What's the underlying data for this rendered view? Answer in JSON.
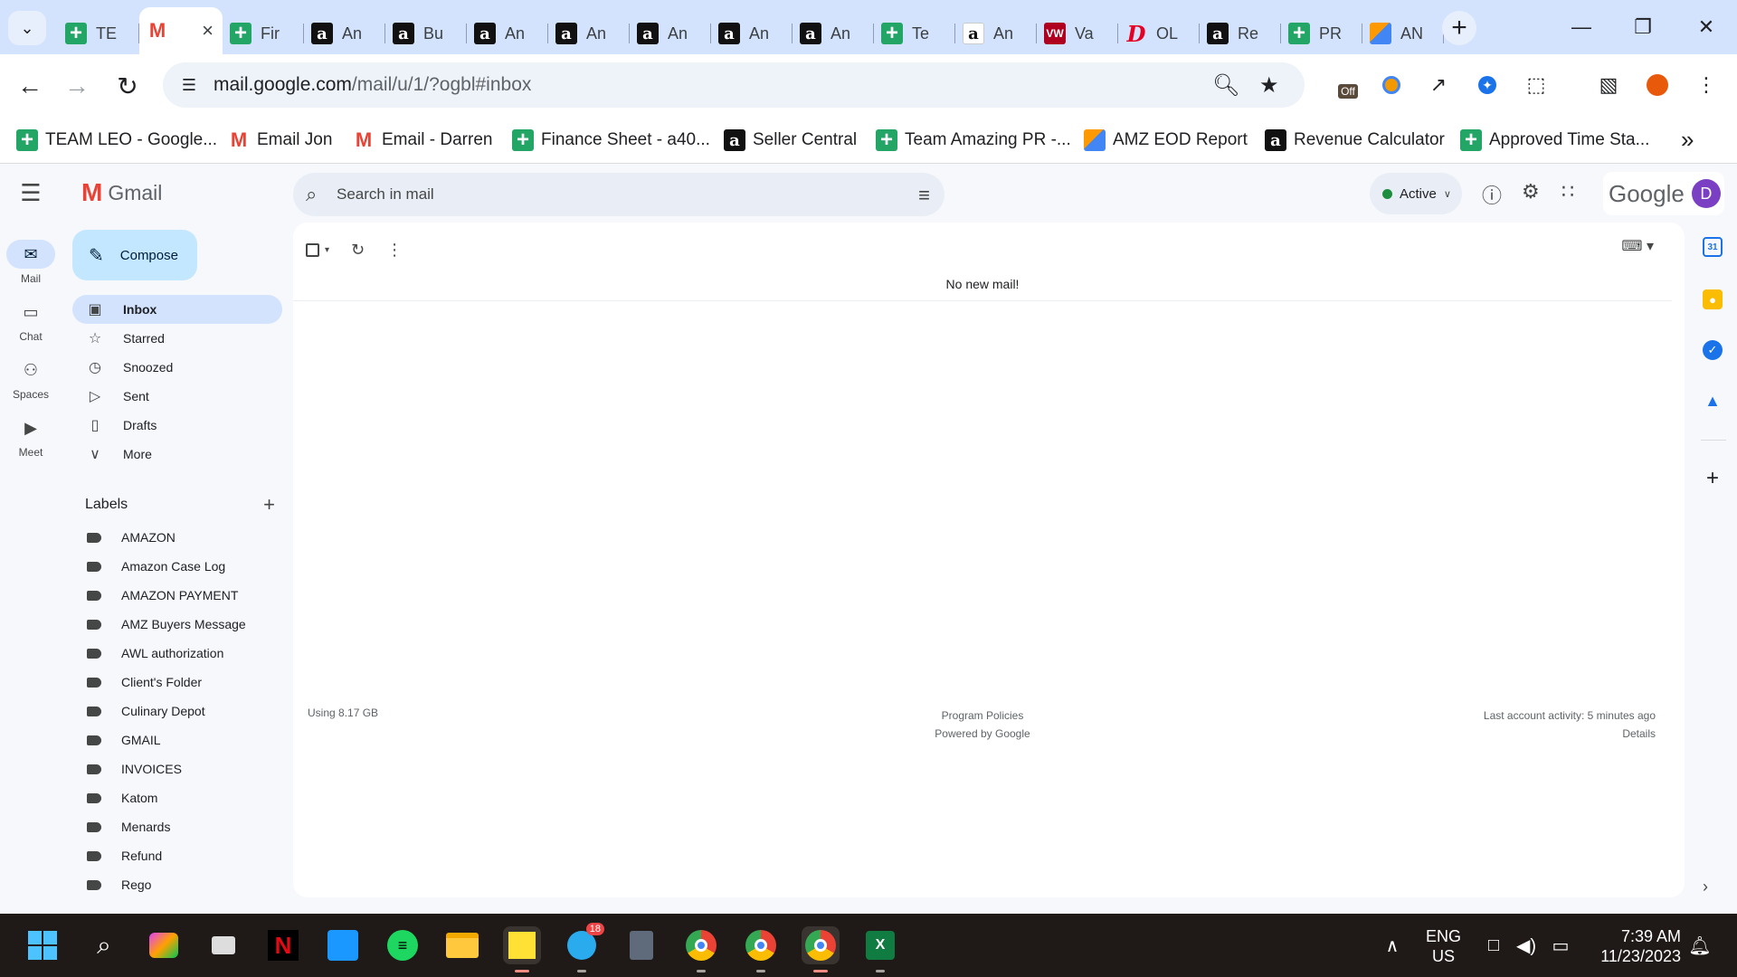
{
  "browser": {
    "tabs": [
      {
        "label": "TE",
        "icon": "sheets-icon"
      },
      {
        "label": "",
        "icon": "gmail-icon",
        "active": true
      },
      {
        "label": "Fir",
        "icon": "sheets-icon"
      },
      {
        "label": "An",
        "icon": "amazon-icon"
      },
      {
        "label": "Bu",
        "icon": "amazon-icon"
      },
      {
        "label": "An",
        "icon": "amazon-icon"
      },
      {
        "label": "An",
        "icon": "amazon-icon"
      },
      {
        "label": "An",
        "icon": "amazon-icon"
      },
      {
        "label": "An",
        "icon": "amazon-icon"
      },
      {
        "label": "An",
        "icon": "amazon-icon"
      },
      {
        "label": "Te",
        "icon": "sheets-icon"
      },
      {
        "label": "An",
        "icon": "amazon-icon"
      },
      {
        "label": "Va",
        "icon": "vw-icon"
      },
      {
        "label": "OL",
        "icon": "pinterest-icon"
      },
      {
        "label": "Re",
        "icon": "amazon-icon"
      },
      {
        "label": "PR",
        "icon": "sheets-icon"
      },
      {
        "label": "AN",
        "icon": "amz-report-icon"
      }
    ],
    "url_host": "mail.google.com",
    "url_path": "/mail/u/1/?ogbl#inbox",
    "extension_off_label": "Off",
    "bookmarks": [
      {
        "label": "TEAM LEO - Google...",
        "icon": "sheets-icon"
      },
      {
        "label": "Email Jon",
        "icon": "gmail-icon"
      },
      {
        "label": "Email - Darren",
        "icon": "gmail-icon"
      },
      {
        "label": "Finance Sheet - a40...",
        "icon": "sheets-icon"
      },
      {
        "label": "Seller Central",
        "icon": "amazon-icon"
      },
      {
        "label": "Team Amazing PR -...",
        "icon": "sheets-icon"
      },
      {
        "label": "AMZ EOD Report",
        "icon": "amz-report-icon"
      },
      {
        "label": "Revenue Calculator",
        "icon": "amazon-icon"
      },
      {
        "label": "Approved Time Sta...",
        "icon": "sheets-icon"
      }
    ]
  },
  "gmail": {
    "logo_text": "Gmail",
    "search_placeholder": "Search in mail",
    "status_label": "Active",
    "google_word": "Google",
    "avatar_initial": "D",
    "rail": [
      {
        "label": "Mail",
        "icon": "mail-icon"
      },
      {
        "label": "Chat",
        "icon": "chat-icon"
      },
      {
        "label": "Spaces",
        "icon": "spaces-icon"
      },
      {
        "label": "Meet",
        "icon": "meet-icon"
      }
    ],
    "compose_label": "Compose",
    "nav": [
      {
        "label": "Inbox",
        "icon": "inbox-icon"
      },
      {
        "label": "Starred",
        "icon": "star-icon"
      },
      {
        "label": "Snoozed",
        "icon": "clock-icon"
      },
      {
        "label": "Sent",
        "icon": "send-icon"
      },
      {
        "label": "Drafts",
        "icon": "draft-icon"
      },
      {
        "label": "More",
        "icon": "chevron-down-icon"
      }
    ],
    "labels_heading": "Labels",
    "labels": [
      "AMAZON",
      "Amazon Case Log",
      "AMAZON PAYMENT",
      "AMZ Buyers Message",
      "AWL authorization",
      "Client's Folder",
      "Culinary Depot",
      "GMAIL",
      "INVOICES",
      "Katom",
      "Menards",
      "Refund",
      "Rego"
    ],
    "empty_message": "No new mail!",
    "storage": "Using 8.17 GB",
    "program_policies": "Program Policies",
    "powered_by": "Powered by Google",
    "last_activity": "Last account activity: 5 minutes ago",
    "details": "Details"
  },
  "taskbar": {
    "telegram_badge": "18",
    "lang_line1": "ENG",
    "lang_line2": "US",
    "time": "7:39 AM",
    "date": "11/23/2023"
  }
}
